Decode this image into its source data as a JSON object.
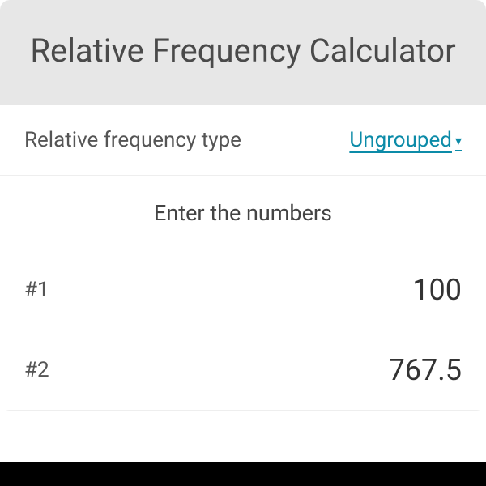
{
  "header": {
    "title": "Relative Frequency Calculator"
  },
  "frequency_type": {
    "label": "Relative frequency type",
    "selected": "Ungrouped"
  },
  "section": {
    "enter_numbers": "Enter the numbers"
  },
  "inputs": [
    {
      "label": "#1",
      "value": "100"
    },
    {
      "label": "#2",
      "value": "767.5"
    }
  ]
}
